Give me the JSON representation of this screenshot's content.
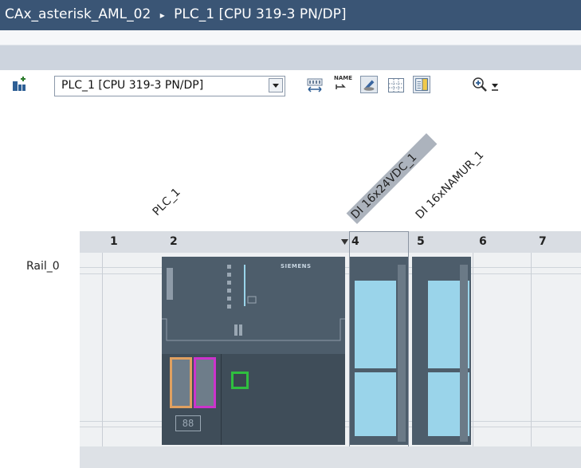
{
  "window": {
    "breadcrumb_project": "CAx_asterisk_AML_02",
    "breadcrumb_separator": "▸",
    "breadcrumb_device": "PLC_1 [CPU 319-3 PN/DP]"
  },
  "toolbar": {
    "device_selector_value": "PLC_1 [CPU 319-3 PN/DP]",
    "name_icon_text": "NAME",
    "icons": [
      "network-view-icon",
      "dropdown-arrow-icon",
      "module-width-icon",
      "show-names-icon",
      "toggle-pen-icon",
      "grid-icon",
      "module-list-icon",
      "zoom-in-icon",
      "zoom-dropdown-icon"
    ]
  },
  "device_labels": {
    "plc": "PLC_1",
    "di_module_1": "DI 16x24VDC_1",
    "di_module_2": "DI 16xNAMUR_1"
  },
  "rack": {
    "rail_label": "Rail_0",
    "slots": [
      "1",
      "2",
      "4",
      "5",
      "6",
      "7"
    ],
    "siemens_logo": "SIEMENS",
    "cpu_display": "88"
  },
  "colors": {
    "title_bar": "#3a5575",
    "module_body": "#4d5d6b",
    "channel_strip": "#9ad4ea",
    "port_orange": "#e0a060",
    "port_magenta": "#cc33cc",
    "port_green": "#2fbf3f"
  }
}
